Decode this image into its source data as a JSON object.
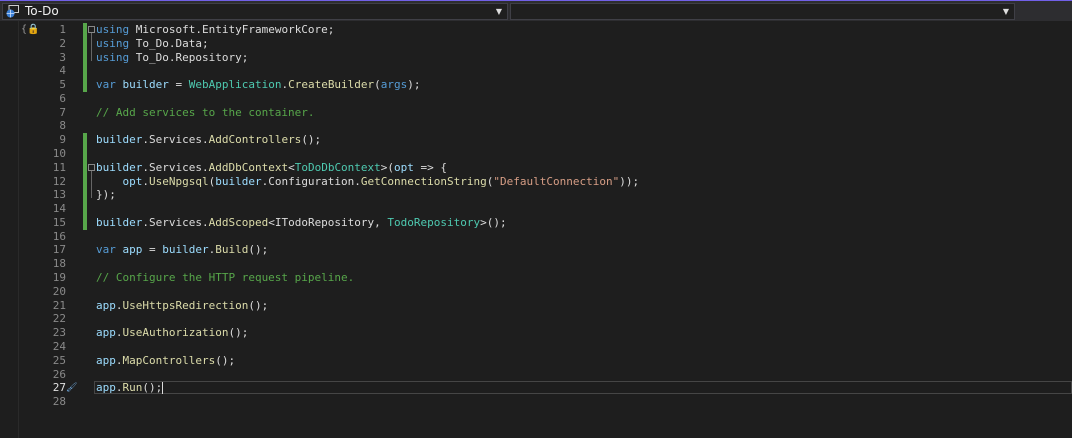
{
  "navbar": {
    "project": "To-Do",
    "member": ""
  },
  "colors": {
    "background": "#1e1e1e",
    "keyword": "#569cd6",
    "type": "#4ec9b0",
    "method": "#dcdcaa",
    "string": "#d69d85",
    "comment": "#57a64a",
    "change_bar": "#57a64a"
  },
  "current_line": 27,
  "changed_lines": [
    1,
    2,
    3,
    4,
    5,
    9,
    10,
    11,
    12,
    13,
    14,
    15
  ],
  "lines": [
    [
      [
        "using",
        "k"
      ],
      [
        " Microsoft.EntityFrameworkCore;",
        "p"
      ]
    ],
    [
      [
        "using",
        "k"
      ],
      [
        " To_Do.Data;",
        "p"
      ]
    ],
    [
      [
        "using",
        "k"
      ],
      [
        " To_Do.Repository;",
        "p"
      ]
    ],
    [],
    [
      [
        "var",
        "k"
      ],
      [
        " builder",
        "v"
      ],
      [
        " = ",
        "p"
      ],
      [
        "WebApplication",
        "t"
      ],
      [
        ".",
        "p"
      ],
      [
        "CreateBuilder",
        "m"
      ],
      [
        "(",
        "p"
      ],
      [
        "args",
        "k"
      ],
      [
        ");",
        "p"
      ]
    ],
    [],
    [
      [
        "// Add services to the container.",
        "c"
      ]
    ],
    [],
    [
      [
        "builder",
        "v"
      ],
      [
        ".Services.",
        "p"
      ],
      [
        "AddControllers",
        "m"
      ],
      [
        "();",
        "p"
      ]
    ],
    [],
    [
      [
        "builder",
        "v"
      ],
      [
        ".Services.",
        "p"
      ],
      [
        "AddDbContext",
        "m"
      ],
      [
        "<",
        "p"
      ],
      [
        "ToDoDbContext",
        "t"
      ],
      [
        ">(",
        "p"
      ],
      [
        "opt",
        "v"
      ],
      [
        " => {",
        "p"
      ]
    ],
    [
      [
        "    opt",
        "v"
      ],
      [
        ".",
        "p"
      ],
      [
        "UseNpgsql",
        "m"
      ],
      [
        "(",
        "p"
      ],
      [
        "builder",
        "v"
      ],
      [
        ".Configuration.",
        "p"
      ],
      [
        "GetConnectionString",
        "m"
      ],
      [
        "(",
        "p"
      ],
      [
        "\"DefaultConnection\"",
        "s"
      ],
      [
        "));",
        "p"
      ]
    ],
    [
      [
        "});",
        "p"
      ]
    ],
    [],
    [
      [
        "builder",
        "v"
      ],
      [
        ".Services.",
        "p"
      ],
      [
        "AddScoped",
        "m"
      ],
      [
        "<",
        "p"
      ],
      [
        "ITodoRepository",
        "n"
      ],
      [
        ", ",
        "p"
      ],
      [
        "TodoRepository",
        "t"
      ],
      [
        ">();",
        "p"
      ]
    ],
    [],
    [
      [
        "var",
        "k"
      ],
      [
        " app",
        "v"
      ],
      [
        " = ",
        "p"
      ],
      [
        "builder",
        "v"
      ],
      [
        ".",
        "p"
      ],
      [
        "Build",
        "m"
      ],
      [
        "();",
        "p"
      ]
    ],
    [],
    [
      [
        "// Configure the HTTP request pipeline.",
        "c"
      ]
    ],
    [],
    [
      [
        "app",
        "v"
      ],
      [
        ".",
        "p"
      ],
      [
        "UseHttpsRedirection",
        "m"
      ],
      [
        "();",
        "p"
      ]
    ],
    [],
    [
      [
        "app",
        "v"
      ],
      [
        ".",
        "p"
      ],
      [
        "UseAuthorization",
        "m"
      ],
      [
        "();",
        "p"
      ]
    ],
    [],
    [
      [
        "app",
        "v"
      ],
      [
        ".",
        "p"
      ],
      [
        "MapControllers",
        "m"
      ],
      [
        "();",
        "p"
      ]
    ],
    [],
    [
      [
        "app",
        "v"
      ],
      [
        ".",
        "p"
      ],
      [
        "Run",
        "m"
      ],
      [
        "();",
        "p"
      ]
    ],
    []
  ]
}
